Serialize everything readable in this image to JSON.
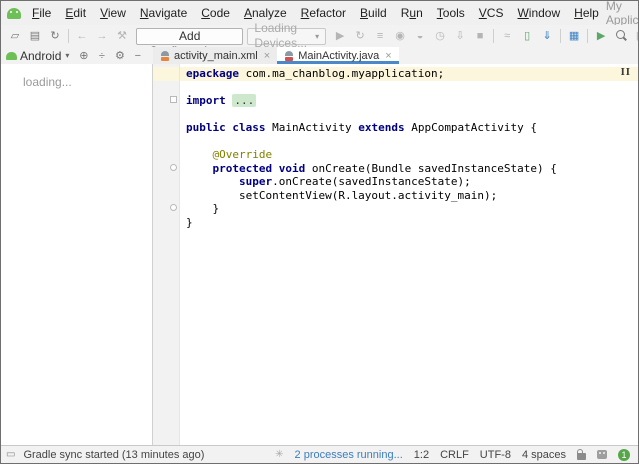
{
  "titlebar": {
    "title": "My Application",
    "menus": [
      {
        "label": "File",
        "u": 0
      },
      {
        "label": "Edit",
        "u": 0
      },
      {
        "label": "View",
        "u": 0
      },
      {
        "label": "Navigate",
        "u": 0
      },
      {
        "label": "Code",
        "u": 0
      },
      {
        "label": "Analyze",
        "u": 0
      },
      {
        "label": "Refactor",
        "u": 0
      },
      {
        "label": "Build",
        "u": 0
      },
      {
        "label": "Run",
        "u": 1
      },
      {
        "label": "Tools",
        "u": 0
      },
      {
        "label": "VCS",
        "u": 0
      },
      {
        "label": "Window",
        "u": 0
      },
      {
        "label": "Help",
        "u": 0
      }
    ],
    "window_controls": {
      "minimize": "—",
      "maximize": "▢",
      "close": "✕"
    }
  },
  "toolbar": {
    "left_icons": [
      {
        "n": "open-icon",
        "g": "▱"
      },
      {
        "n": "save-icon",
        "g": "▤"
      },
      {
        "n": "sync-icon",
        "g": "↻"
      },
      {
        "n": "sep"
      },
      {
        "n": "back-icon",
        "g": "←",
        "dim": true
      },
      {
        "n": "forward-icon",
        "g": "→",
        "dim": true
      },
      {
        "n": "build-hammer-icon",
        "g": "⚒",
        "dim": true
      }
    ],
    "add_configuration_label": "Add Configuration...",
    "device_select_label": "Loading Devices...",
    "device_select_caret": "▾",
    "right_icons": [
      {
        "n": "run-icon",
        "g": "▶",
        "dim": true
      },
      {
        "n": "apply-changes-icon",
        "g": "↻",
        "dim": true
      },
      {
        "n": "apply-code-changes-icon",
        "g": "≡",
        "dim": true
      },
      {
        "n": "debug-icon",
        "g": "◉",
        "dim": true
      },
      {
        "n": "coverage-icon",
        "g": "◒",
        "dim": true
      },
      {
        "n": "profiler-icon",
        "g": "◷",
        "dim": true
      },
      {
        "n": "attach-debugger-icon",
        "g": "⇩",
        "dim": true
      },
      {
        "n": "stop-icon",
        "g": "■",
        "dim": true
      },
      {
        "n": "sep"
      },
      {
        "n": "gradle-sync-icon",
        "g": "≈",
        "dim": true
      },
      {
        "n": "device-manager-icon",
        "g": "▯",
        "accent": "green"
      },
      {
        "n": "sdk-manager-icon",
        "g": "⇓",
        "accent": "blue"
      },
      {
        "n": "sep"
      },
      {
        "n": "project-structure-icon",
        "g": "▦",
        "accent": "blue"
      },
      {
        "n": "sep"
      },
      {
        "n": "run-anything-icon",
        "g": "▶",
        "accent": "green"
      },
      {
        "n": "search-icon",
        "g": "",
        "css": "search"
      },
      {
        "n": "settings-icon",
        "g": "▩",
        "dim": true
      }
    ]
  },
  "project_panel": {
    "selector_label": "Android",
    "selector_caret": "▾",
    "icons": {
      "select_opened_file": "⊕",
      "collapse_all": "÷",
      "settings_gear": "⚙",
      "hide_panel": "−"
    },
    "loading_text": "loading..."
  },
  "tabs": [
    {
      "label": "activity_main.xml",
      "icon": "xml",
      "close": "×",
      "active": false
    },
    {
      "label": "MainActivity.java",
      "icon": "java",
      "close": "×",
      "active": true
    }
  ],
  "editor": {
    "pause_indicator": "II",
    "fold_circle_lines": [
      8,
      11
    ],
    "fold_box_lines": [
      3
    ],
    "lines": [
      {
        "hl": true,
        "seg": [
          [
            "k",
            "epackage"
          ],
          [
            "p",
            " com.ma_chanblog.myapplication;"
          ]
        ]
      },
      {
        "seg": []
      },
      {
        "seg": [
          [
            "k",
            "import"
          ],
          [
            "p",
            " "
          ],
          [
            "f",
            "..."
          ]
        ]
      },
      {
        "seg": []
      },
      {
        "seg": [
          [
            "k",
            "public"
          ],
          [
            "p",
            " "
          ],
          [
            "k",
            "class"
          ],
          [
            "p",
            " MainActivity "
          ],
          [
            "k",
            "extends"
          ],
          [
            "p",
            " AppCompatActivity {"
          ]
        ]
      },
      {
        "seg": []
      },
      {
        "seg": [
          [
            "p",
            "    "
          ],
          [
            "a",
            "@Override"
          ]
        ]
      },
      {
        "seg": [
          [
            "p",
            "    "
          ],
          [
            "k",
            "protected"
          ],
          [
            "p",
            " "
          ],
          [
            "k",
            "void"
          ],
          [
            "p",
            " onCreate(Bundle savedInstanceState) {"
          ]
        ]
      },
      {
        "seg": [
          [
            "p",
            "        "
          ],
          [
            "k",
            "super"
          ],
          [
            "p",
            ".onCreate(savedInstanceState);"
          ]
        ]
      },
      {
        "seg": [
          [
            "p",
            "        setContentView(R.layout.activity_main);"
          ]
        ]
      },
      {
        "seg": [
          [
            "p",
            "    }"
          ]
        ]
      },
      {
        "seg": [
          [
            "p",
            "}"
          ]
        ]
      }
    ]
  },
  "statusbar": {
    "toggle_icon": "▭",
    "message": "Gradle sync started (13 minutes ago)",
    "spinner_icon": "✳",
    "processes_label": "2 processes running...",
    "caret_position": "1:2",
    "line_separator": "CRLF",
    "encoding": "UTF-8",
    "indent": "4 spaces",
    "badge_count": "1"
  },
  "colors": {
    "accent_blue": "#4a88c7",
    "android_green": "#6fbf59",
    "keyword": "#000080",
    "annotation": "#808000",
    "caret_line_bg": "#fcf6dc",
    "fold_bg": "#cde8cd",
    "link_blue": "#3d7dbd",
    "badge_green": "#57a64a"
  }
}
